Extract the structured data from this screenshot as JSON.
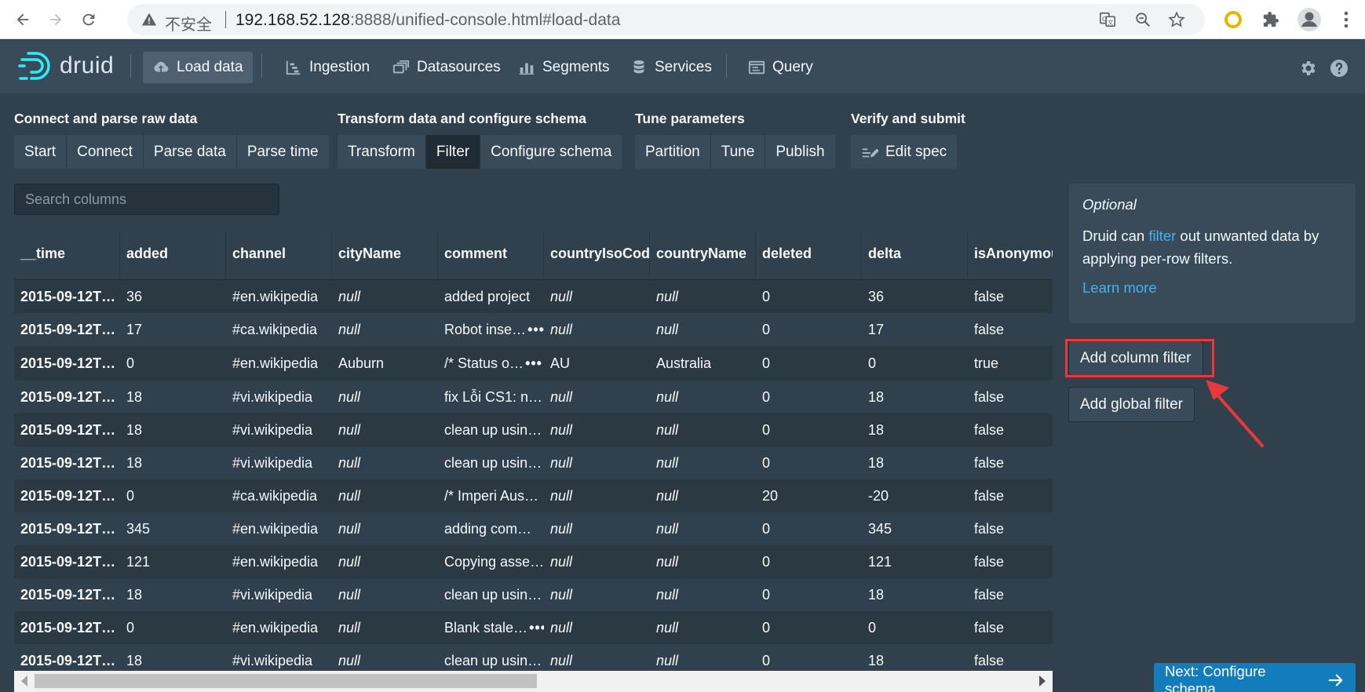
{
  "browser": {
    "security_label": "不安全",
    "url_host": "192.168.52.128",
    "url_rest": ":8888/unified-console.html#load-data"
  },
  "header": {
    "logo_text": "druid",
    "nav": [
      {
        "label": "Load data",
        "icon": "cloud-upload-icon",
        "active": true
      },
      {
        "label": "Ingestion",
        "icon": "gantt-chart-icon"
      },
      {
        "label": "Datasources",
        "icon": "multi-select-icon"
      },
      {
        "label": "Segments",
        "icon": "stacked-chart-icon"
      },
      {
        "label": "Services",
        "icon": "database-icon"
      },
      {
        "label": "Query",
        "icon": "application-icon"
      }
    ]
  },
  "steps": {
    "group1": {
      "title": "Connect and parse raw data",
      "items": [
        "Start",
        "Connect",
        "Parse data",
        "Parse time"
      ]
    },
    "group2": {
      "title": "Transform data and configure schema",
      "items": [
        "Transform",
        "Filter",
        "Configure schema"
      ]
    },
    "group3": {
      "title": "Tune parameters",
      "items": [
        "Partition",
        "Tune",
        "Publish"
      ]
    },
    "group4": {
      "title": "Verify and submit",
      "items": [
        "Edit spec"
      ]
    }
  },
  "search": {
    "placeholder": "Search columns"
  },
  "table": {
    "columns": [
      "__time",
      "added",
      "channel",
      "cityName",
      "comment",
      "countryIsoCod",
      "countryName",
      "deleted",
      "delta",
      "isAnonymou"
    ],
    "rows": [
      [
        "2015-09-12T…",
        "36",
        "#en.wikipedia",
        "null",
        "added project",
        "null",
        "null",
        "0",
        "36",
        "false"
      ],
      [
        "2015-09-12T…",
        "17",
        "#ca.wikipedia",
        "null",
        "Robot inse…",
        "null",
        "null",
        "0",
        "17",
        "false"
      ],
      [
        "2015-09-12T…",
        "0",
        "#en.wikipedia",
        "Auburn",
        "/* Status o…",
        "AU",
        "Australia",
        "0",
        "0",
        "true"
      ],
      [
        "2015-09-12T…",
        "18",
        "#vi.wikipedia",
        "null",
        "fix Lỗi CS1: n…",
        "null",
        "null",
        "0",
        "18",
        "false"
      ],
      [
        "2015-09-12T…",
        "18",
        "#vi.wikipedia",
        "null",
        "clean up usin…",
        "null",
        "null",
        "0",
        "18",
        "false"
      ],
      [
        "2015-09-12T…",
        "18",
        "#vi.wikipedia",
        "null",
        "clean up usin…",
        "null",
        "null",
        "0",
        "18",
        "false"
      ],
      [
        "2015-09-12T…",
        "0",
        "#ca.wikipedia",
        "null",
        "/* Imperi Aus…",
        "null",
        "null",
        "20",
        "-20",
        "false"
      ],
      [
        "2015-09-12T…",
        "345",
        "#en.wikipedia",
        "null",
        "adding com…",
        "null",
        "null",
        "0",
        "345",
        "false"
      ],
      [
        "2015-09-12T…",
        "121",
        "#en.wikipedia",
        "null",
        "Copying asse…",
        "null",
        "null",
        "0",
        "121",
        "false"
      ],
      [
        "2015-09-12T…",
        "18",
        "#vi.wikipedia",
        "null",
        "clean up usin…",
        "null",
        "null",
        "0",
        "18",
        "false"
      ],
      [
        "2015-09-12T…",
        "0",
        "#en.wikipedia",
        "null",
        "Blank stale…",
        "null",
        "null",
        "0",
        "0",
        "false"
      ],
      [
        "2015-09-12T…",
        "18",
        "#vi.wikipedia",
        "null",
        "clean up usin…",
        "null",
        "null",
        "0",
        "18",
        "false"
      ]
    ],
    "expandable_rows": [
      1,
      2,
      10
    ]
  },
  "callout": {
    "title": "Optional",
    "text_before": "Druid can ",
    "link_word": "filter",
    "text_after": " out unwanted data by applying per-row filters.",
    "learn_more": "Learn more"
  },
  "actions": {
    "add_column_filter": "Add column filter",
    "add_global_filter": "Add global filter",
    "next": "Next: Configure schema"
  },
  "colors": {
    "background": "#30404d",
    "header": "#394b59",
    "accent": "#137cbd",
    "link": "#48aff0",
    "highlight": "#e8383a"
  }
}
